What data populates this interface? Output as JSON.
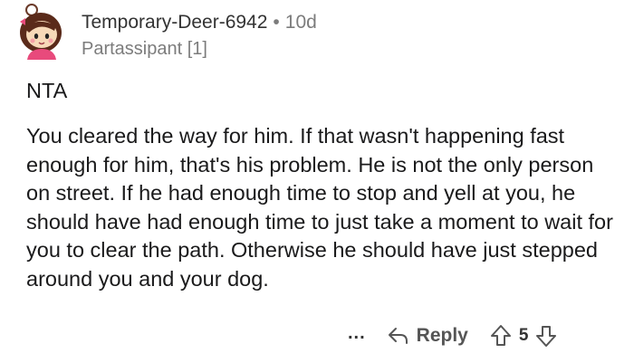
{
  "comment": {
    "author": "Temporary-Deer-6942",
    "separator": "•",
    "age": "10d",
    "flair": "Partassipant [1]",
    "paragraphs": [
      "NTA",
      "You cleared the way for him. If that wasn't happening fast enough for him, that's his problem. He is not the only person on street. If he had enough time to stop and yell at you, he should have had enough time to just take a moment to wait for you to clear the path. Otherwise he should have just stepped around you and your dog."
    ]
  },
  "actions": {
    "more_label": "...",
    "reply_label": "Reply",
    "score": "5"
  },
  "icons": {
    "avatar": "avatar-illustration",
    "more": "more-options-icon",
    "reply": "reply-arrow-icon",
    "upvote": "upvote-arrow-icon",
    "downvote": "downvote-arrow-icon"
  }
}
